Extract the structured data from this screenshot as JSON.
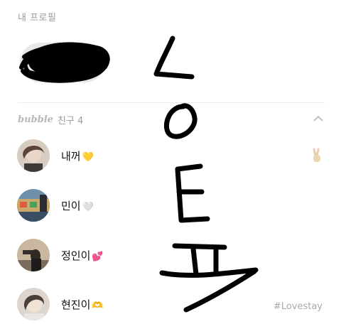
{
  "my_profile": {
    "label": "내 프로필"
  },
  "friends_section": {
    "brand": "bubble",
    "title": "친구 4",
    "collapse_icon": "chevron-up-icon"
  },
  "friends": [
    {
      "name": "내꺼",
      "emoji": "💛",
      "status_icon": "peace-hand-icon"
    },
    {
      "name": "민이",
      "emoji": "🤍"
    },
    {
      "name": "정인이",
      "emoji": "💕"
    },
    {
      "name": "현진이",
      "emoji": "🫶",
      "status_message": "#Lovestay"
    }
  ],
  "overlay_drawing": {
    "letters": [
      "L",
      "O",
      "E",
      "ㅍ"
    ],
    "color": "#000000"
  }
}
